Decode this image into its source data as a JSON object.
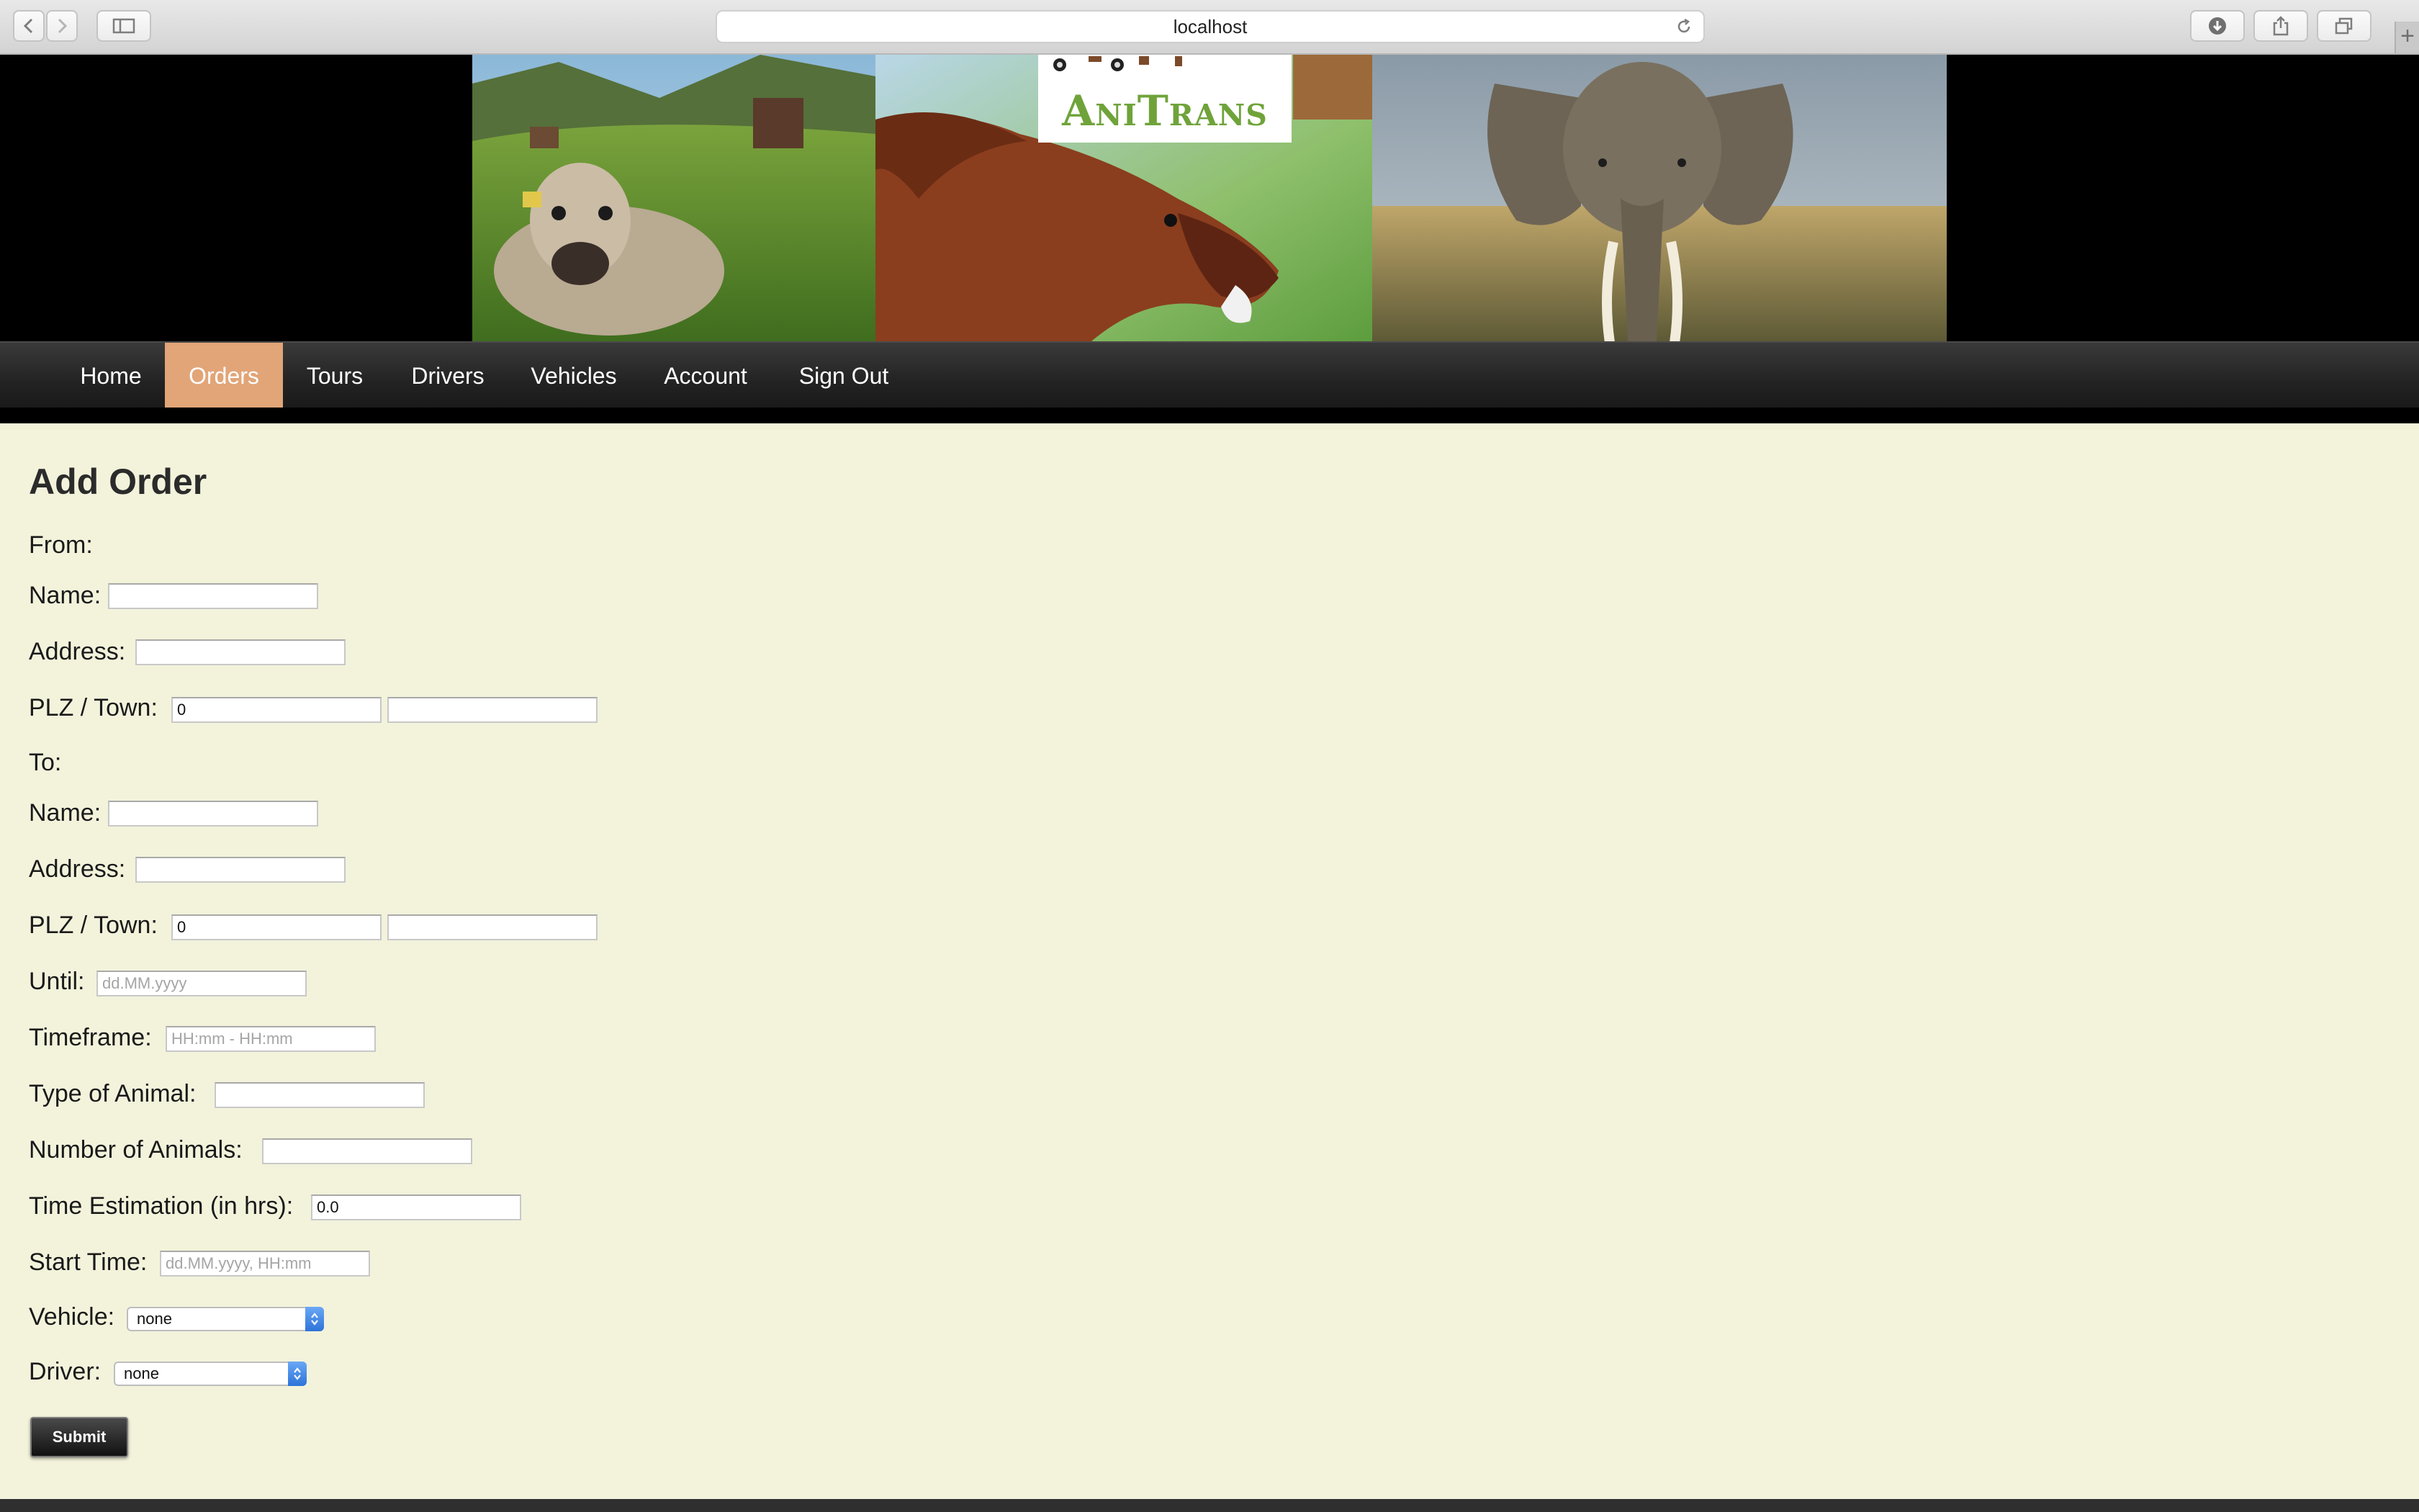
{
  "browser": {
    "url": "localhost",
    "icons": [
      "back-icon",
      "forward-icon",
      "sidebar-icon",
      "reload-icon",
      "download-icon",
      "share-icon",
      "tabs-icon",
      "new-tab-icon"
    ],
    "new_tab_symbol": "+"
  },
  "site": {
    "logo": "AniTrans",
    "accent_color": "#e1a578",
    "background_color": "#f3f3dc"
  },
  "nav": {
    "items": [
      {
        "label": "Home"
      },
      {
        "label": "Orders",
        "active": true
      },
      {
        "label": "Tours"
      },
      {
        "label": "Drivers"
      },
      {
        "label": "Vehicles"
      },
      {
        "label": "Account"
      },
      {
        "label": "Sign Out"
      }
    ]
  },
  "form": {
    "title": "Add Order",
    "from_label": "From:",
    "to_label": "To:",
    "from": {
      "name_label": "Name:",
      "name_value": "",
      "address_label": "Address:",
      "address_value": "",
      "plz_town_label": "PLZ / Town:",
      "plz_value": "0",
      "town_value": ""
    },
    "to": {
      "name_label": "Name:",
      "name_value": "",
      "address_label": "Address:",
      "address_value": "",
      "plz_town_label": "PLZ / Town:",
      "plz_value": "0",
      "town_value": ""
    },
    "until": {
      "label": "Until:",
      "value": "",
      "placeholder": "dd.MM.yyyy"
    },
    "timeframe": {
      "label": "Timeframe:",
      "value": "",
      "placeholder": "HH:mm - HH:mm"
    },
    "animal_type": {
      "label": "Type of Animal:",
      "value": ""
    },
    "animal_count": {
      "label": "Number of Animals:",
      "value": ""
    },
    "time_estimation": {
      "label": "Time Estimation (in hrs):",
      "value": "0.0"
    },
    "start_time": {
      "label": "Start Time:",
      "value": "",
      "placeholder": "dd.MM.yyyy, HH:mm"
    },
    "vehicle": {
      "label": "Vehicle:",
      "selected": "none"
    },
    "driver": {
      "label": "Driver:",
      "selected": "none"
    },
    "submit_label": "Submit"
  }
}
